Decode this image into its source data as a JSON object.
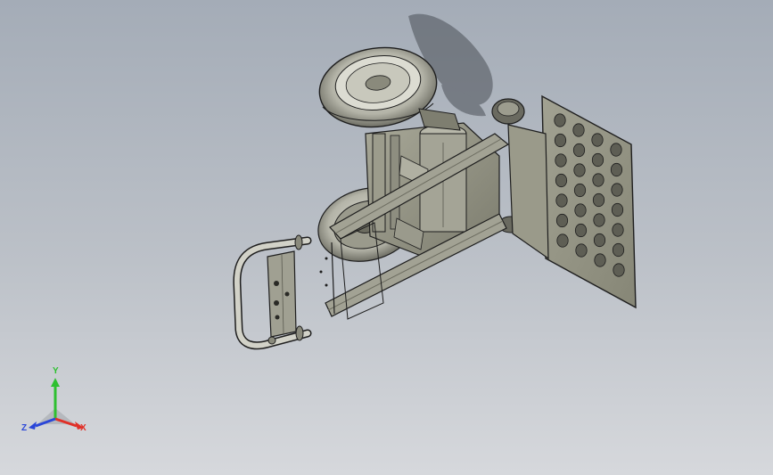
{
  "viewport": {
    "background_top": "#a4acb7",
    "background_bottom": "#d6d8dc"
  },
  "model": {
    "part_color": "#8c8c7c",
    "edge_color": "#1e1e1e",
    "shadow_color": "#4a4f56"
  },
  "triad": {
    "x_label": "X",
    "y_label": "Y",
    "z_label": "Z",
    "x_color": "#e03028",
    "y_color": "#2ec030",
    "z_color": "#2a46d8"
  }
}
